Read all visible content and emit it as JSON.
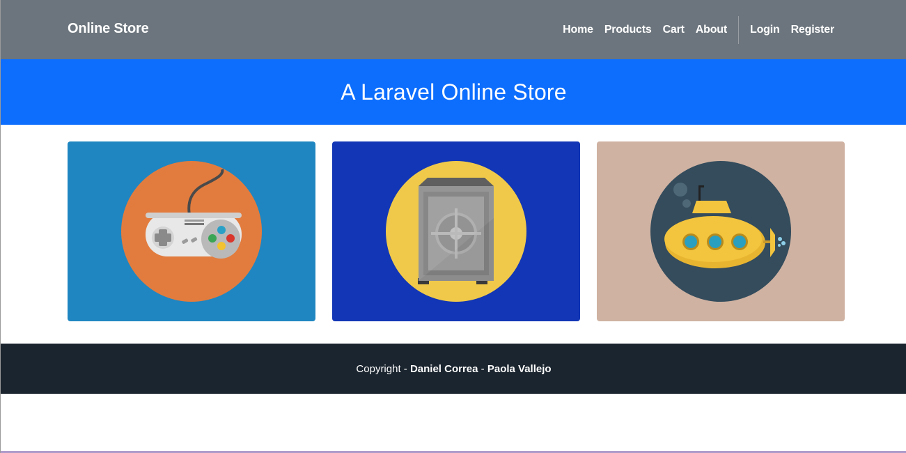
{
  "navbar": {
    "brand": "Online Store",
    "links": [
      "Home",
      "Products",
      "Cart",
      "About"
    ],
    "auth_links": [
      "Login",
      "Register"
    ],
    "bg_color": "#6c757d"
  },
  "hero": {
    "title": "A Laravel Online Store",
    "bg_color": "#0d6efd"
  },
  "cards": [
    {
      "icon": "game-controller-icon",
      "bg_color": "#1f86c1",
      "circle_color": "#e27c3e"
    },
    {
      "icon": "safe-icon",
      "bg_color": "#1236b5",
      "circle_color": "#f0c94a"
    },
    {
      "icon": "submarine-icon",
      "bg_color": "#cfb2a2",
      "circle_color": "#344c5c"
    }
  ],
  "footer": {
    "prefix": "Copyright - ",
    "author1": "Daniel Correa",
    "separator": " - ",
    "author2": "Paola Vallejo",
    "bg_color": "#1b252f"
  }
}
